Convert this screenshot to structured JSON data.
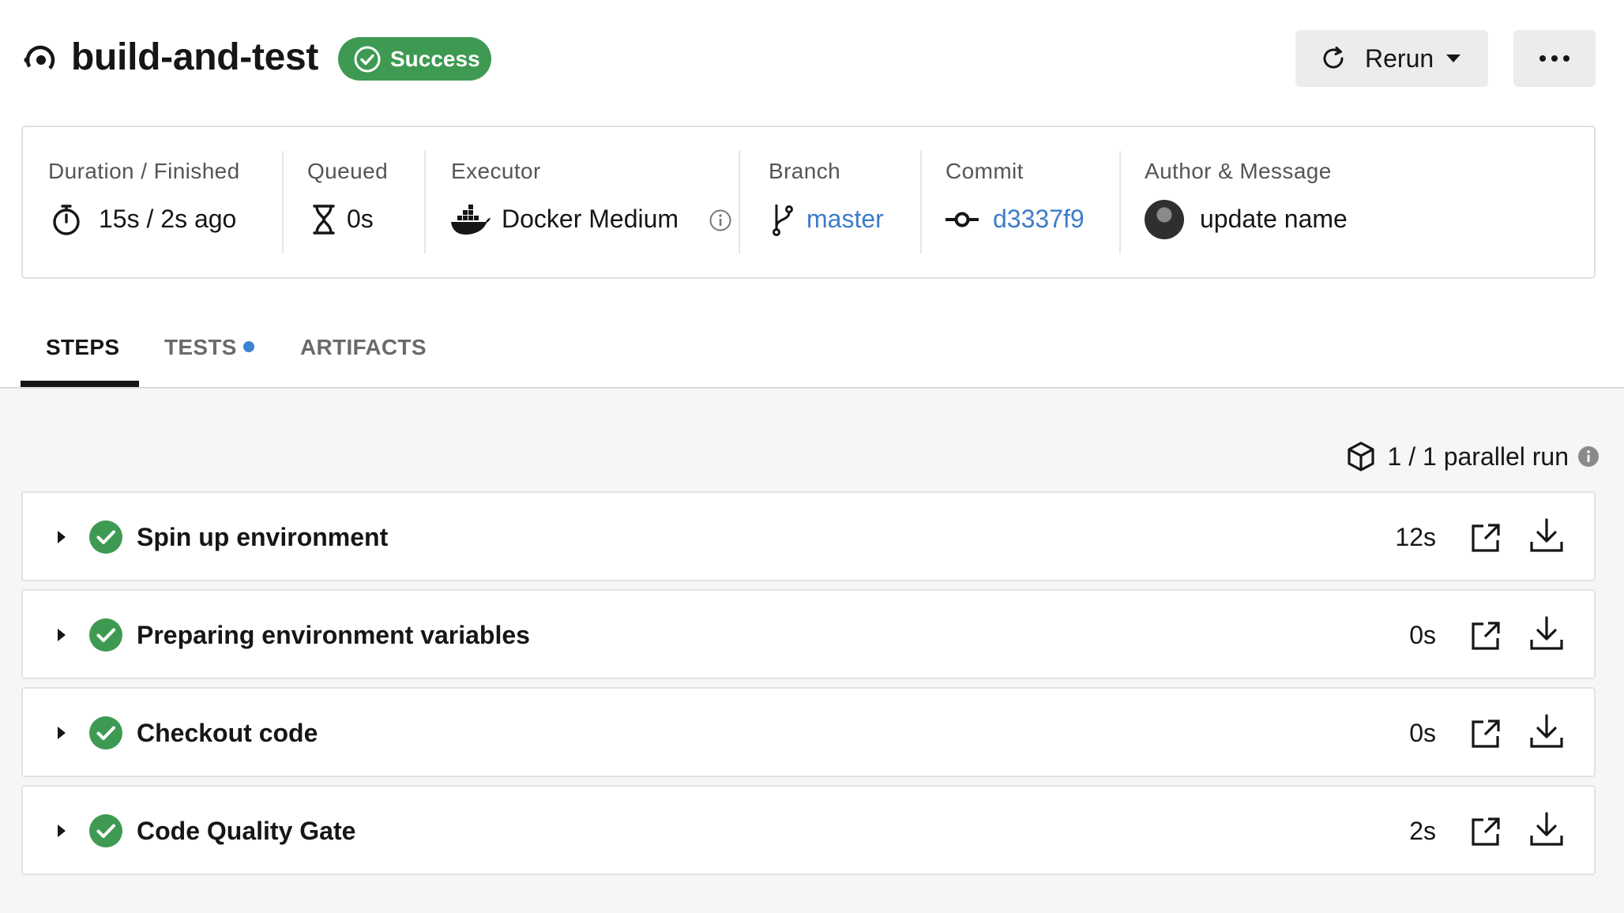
{
  "header": {
    "job_icon": "pipeline-job-icon",
    "title": "build-and-test",
    "status": "Success",
    "status_color": "#3e9a52",
    "rerun_label": "Rerun",
    "more_icon": "ellipsis-icon"
  },
  "info": {
    "duration": {
      "label": "Duration / Finished",
      "value": "15s / 2s ago",
      "icon": "stopwatch-icon"
    },
    "queued": {
      "label": "Queued",
      "value": "0s",
      "icon": "hourglass-icon"
    },
    "executor": {
      "label": "Executor",
      "value": "Docker Medium",
      "icon": "docker-icon"
    },
    "branch": {
      "label": "Branch",
      "value": "master",
      "icon": "branch-icon"
    },
    "commit": {
      "label": "Commit",
      "value": "d3337f9",
      "icon": "commit-icon"
    },
    "author": {
      "label": "Author & Message",
      "value": "update name"
    },
    "link_color": "#3d7cc9"
  },
  "tabs": [
    {
      "label": "STEPS",
      "active": true
    },
    {
      "label": "TESTS",
      "active": false,
      "dot": true
    },
    {
      "label": "ARTIFACTS",
      "active": false
    }
  ],
  "parallel": {
    "text": "1 / 1 parallel run"
  },
  "steps": [
    {
      "name": "Spin up environment",
      "duration": "12s"
    },
    {
      "name": "Preparing environment variables",
      "duration": "0s"
    },
    {
      "name": "Checkout code",
      "duration": "0s"
    },
    {
      "name": "Code Quality Gate",
      "duration": "2s"
    }
  ]
}
